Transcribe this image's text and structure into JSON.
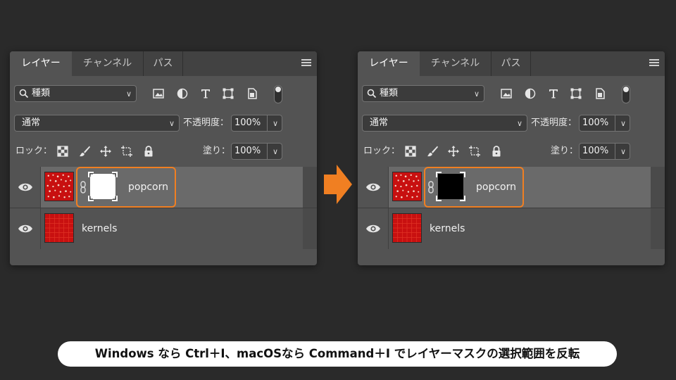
{
  "panels": [
    {
      "tabs": [
        "レイヤー",
        "チャンネル",
        "パス"
      ],
      "filter_label": "種類",
      "blend_mode": "通常",
      "opacity_label": "不透明度：",
      "opacity_value": "100%",
      "lock_label": "ロック：",
      "fill_label": "塗り：",
      "fill_value": "100%",
      "layers": [
        {
          "name": "popcorn",
          "mask": "white",
          "visible": true,
          "selected": true
        },
        {
          "name": "kernels",
          "visible": true,
          "selected": false
        }
      ]
    },
    {
      "tabs": [
        "レイヤー",
        "チャンネル",
        "パス"
      ],
      "filter_label": "種類",
      "blend_mode": "通常",
      "opacity_label": "不透明度：",
      "opacity_value": "100%",
      "lock_label": "ロック：",
      "fill_label": "塗り：",
      "fill_value": "100%",
      "layers": [
        {
          "name": "popcorn",
          "mask": "black",
          "visible": true,
          "selected": true
        },
        {
          "name": "kernels",
          "visible": true,
          "selected": false
        }
      ]
    }
  ],
  "caption": "Windows なら Ctrl＋I、macOSなら Command＋I でレイヤーマスクの選択範囲を反転",
  "colors": {
    "highlight": "#f07f22",
    "arrow": "#f07f22",
    "background": "#2a2a2a",
    "panel": "#535353"
  },
  "icons": [
    "search-icon",
    "image-filter-icon",
    "adjustment-filter-icon",
    "type-filter-icon",
    "shape-filter-icon",
    "smart-object-filter-icon",
    "filter-toggle",
    "lock-transparent-icon",
    "lock-brush-icon",
    "lock-position-icon",
    "lock-artboard-icon",
    "lock-all-icon",
    "eye-icon",
    "link-icon",
    "panel-menu-icon",
    "right-arrow-icon"
  ]
}
